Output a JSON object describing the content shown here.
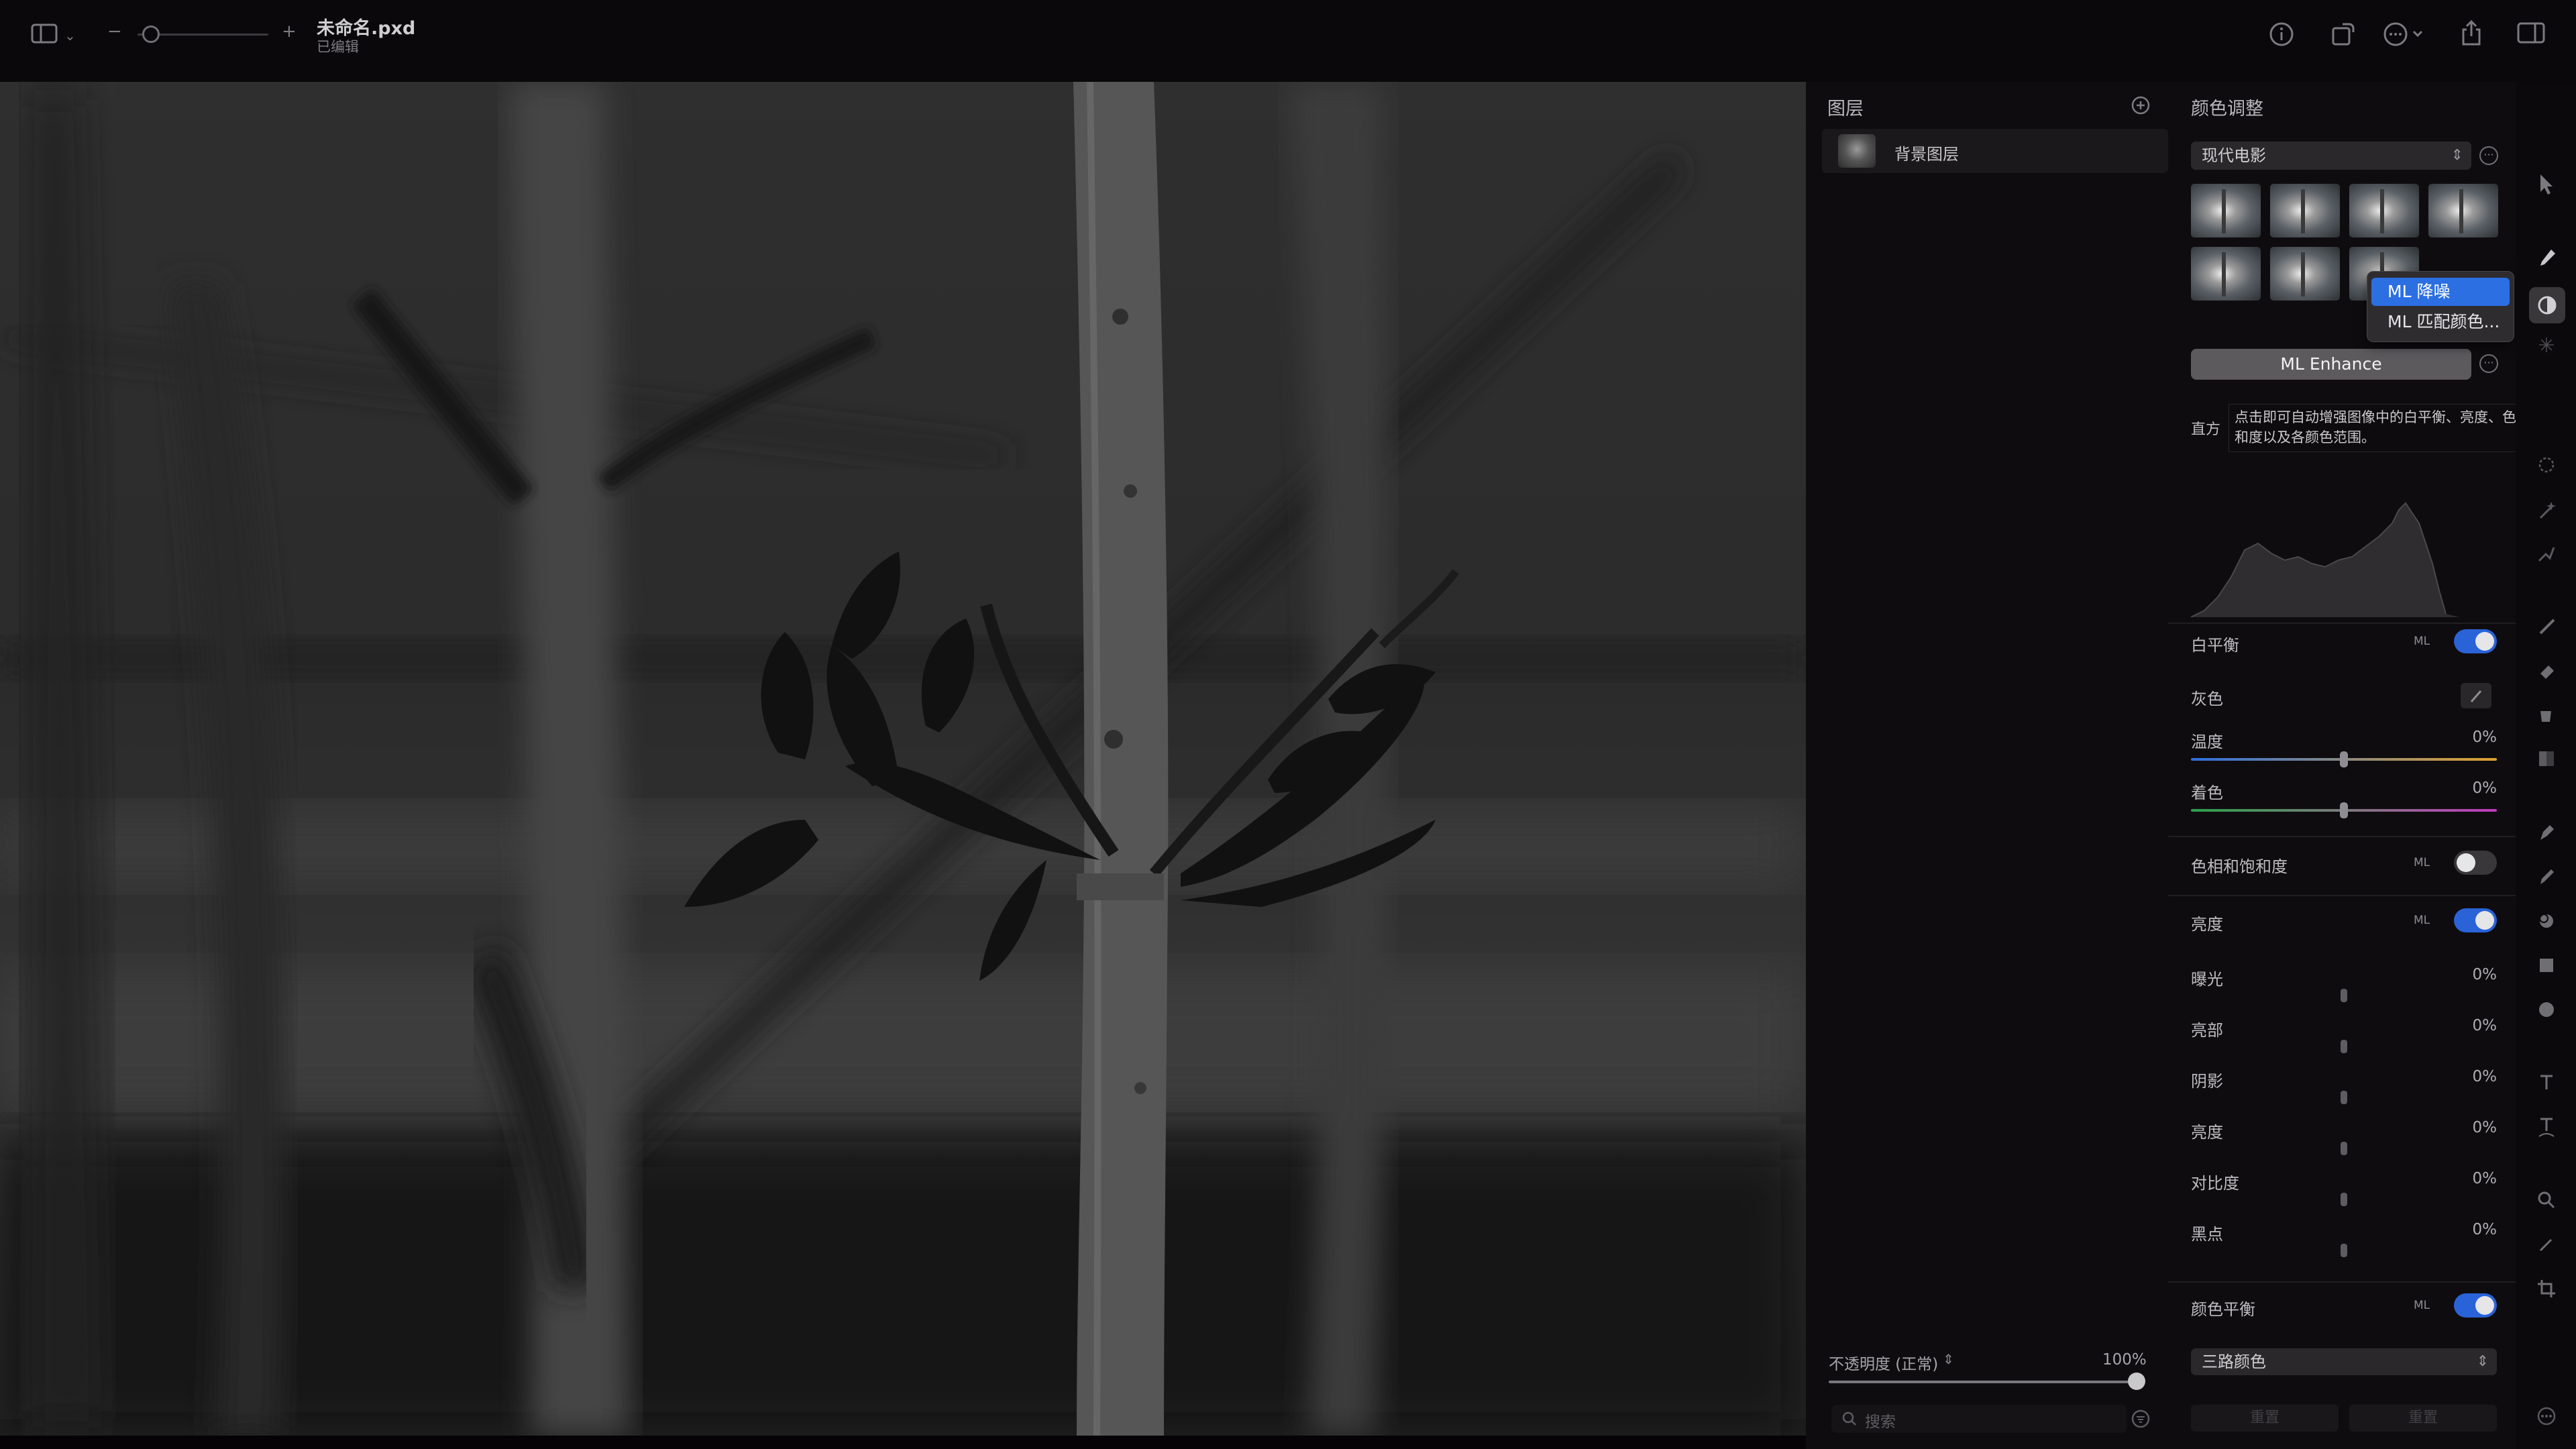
{
  "document": {
    "title": "未命名.pxd",
    "status": "已编辑"
  },
  "toolbar": {
    "sidebar_toggle_icon": "sidebar-icon",
    "zoom_out": "−",
    "zoom_in": "+"
  },
  "layers_panel": {
    "title": "图层",
    "add_icon": "plus-circle-icon",
    "layers": [
      {
        "name": "背景图层"
      }
    ],
    "opacity_label": "不透明度 (正常)",
    "opacity_value": "100%",
    "search_placeholder": "搜索"
  },
  "adjust_panel": {
    "title": "颜色调整",
    "preset_select": "现代电影",
    "enhance_button": "ML Enhance",
    "tooltip": "点击即可自动增强图像中的白平衡、亮度、色调和饱和度以及各颜色范围。",
    "histogram_label": "直方",
    "white_balance": {
      "label": "白平衡",
      "ml": "ML",
      "enabled": true,
      "gray_label": "灰色",
      "temperature": {
        "label": "温度",
        "value": "0%"
      },
      "tint": {
        "label": "着色",
        "value": "0%"
      }
    },
    "hue_saturation": {
      "label": "色相和饱和度",
      "ml": "ML",
      "enabled": false
    },
    "lightness": {
      "label": "亮度",
      "ml": "ML",
      "enabled": true,
      "rows": [
        {
          "label": "曝光",
          "value": "0%"
        },
        {
          "label": "亮部",
          "value": "0%"
        },
        {
          "label": "阴影",
          "value": "0%"
        },
        {
          "label": "亮度",
          "value": "0%"
        },
        {
          "label": "对比度",
          "value": "0%"
        },
        {
          "label": "黑点",
          "value": "0%"
        }
      ]
    },
    "color_balance": {
      "label": "颜色平衡",
      "ml": "ML",
      "enabled": true,
      "mode_select": "三路颜色"
    },
    "footer_buttons": [
      "重置",
      "重置"
    ]
  },
  "context_menu": {
    "items": [
      {
        "label": "ML 降噪",
        "selected": true
      },
      {
        "label": "ML 匹配颜色...",
        "selected": false
      }
    ]
  },
  "colors": {
    "accent": "#2a63d8",
    "menu_highlight": "#2b6fe3",
    "background": "#0f0c0f"
  }
}
